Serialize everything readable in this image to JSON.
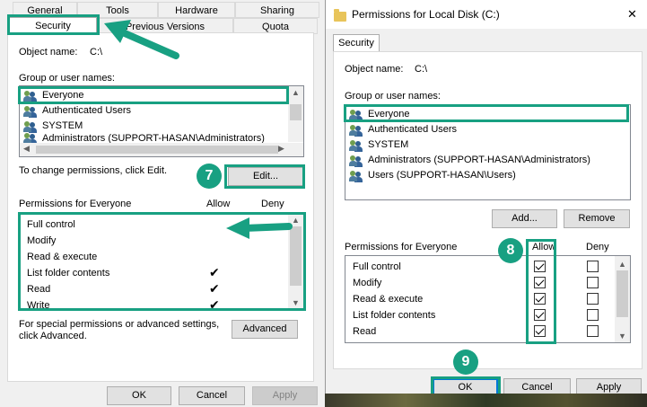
{
  "left_dialog": {
    "tabs_row1": [
      "General",
      "Tools",
      "Hardware",
      "Sharing"
    ],
    "tabs_row2": [
      "Security",
      "Previous Versions",
      "Quota"
    ],
    "object_name_label": "Object name:",
    "object_name_value": "C:\\",
    "group_label": "Group or user names:",
    "users": [
      "Everyone",
      "Authenticated Users",
      "SYSTEM",
      "Administrators (SUPPORT-HASAN\\Administrators)"
    ],
    "change_text": "To change permissions, click Edit.",
    "edit_button": "Edit...",
    "permissions_label": "Permissions for Everyone",
    "allow_header": "Allow",
    "deny_header": "Deny",
    "permissions": [
      {
        "name": "Full control",
        "allow": false
      },
      {
        "name": "Modify",
        "allow": false
      },
      {
        "name": "Read & execute",
        "allow": false
      },
      {
        "name": "List folder contents",
        "allow": true
      },
      {
        "name": "Read",
        "allow": true
      },
      {
        "name": "Write",
        "allow": true
      }
    ],
    "special_text_1": "For special permissions or advanced settings,",
    "special_text_2": "click Advanced.",
    "advanced_button": "Advanced",
    "ok_button": "OK",
    "cancel_button": "Cancel",
    "apply_button": "Apply"
  },
  "right_dialog": {
    "title": "Permissions for Local Disk (C:)",
    "close_glyph": "✕",
    "tab": "Security",
    "object_name_label": "Object name:",
    "object_name_value": "C:\\",
    "group_label": "Group or user names:",
    "users": [
      "Everyone",
      "Authenticated Users",
      "SYSTEM",
      "Administrators (SUPPORT-HASAN\\Administrators)",
      "Users (SUPPORT-HASAN\\Users)"
    ],
    "add_button": "Add...",
    "remove_button": "Remove",
    "permissions_label": "Permissions for Everyone",
    "allow_header": "Allow",
    "deny_header": "Deny",
    "permissions": [
      {
        "name": "Full control",
        "allow": true,
        "deny": false
      },
      {
        "name": "Modify",
        "allow": true,
        "deny": false
      },
      {
        "name": "Read & execute",
        "allow": true,
        "deny": false
      },
      {
        "name": "List folder contents",
        "allow": true,
        "deny": false
      },
      {
        "name": "Read",
        "allow": true,
        "deny": false
      }
    ],
    "ok_button": "OK",
    "cancel_button": "Cancel",
    "apply_button": "Apply"
  },
  "badges": [
    "7",
    "8",
    "9"
  ],
  "colors": {
    "highlight": "#18a082",
    "focus_blue": "#0078d7"
  }
}
